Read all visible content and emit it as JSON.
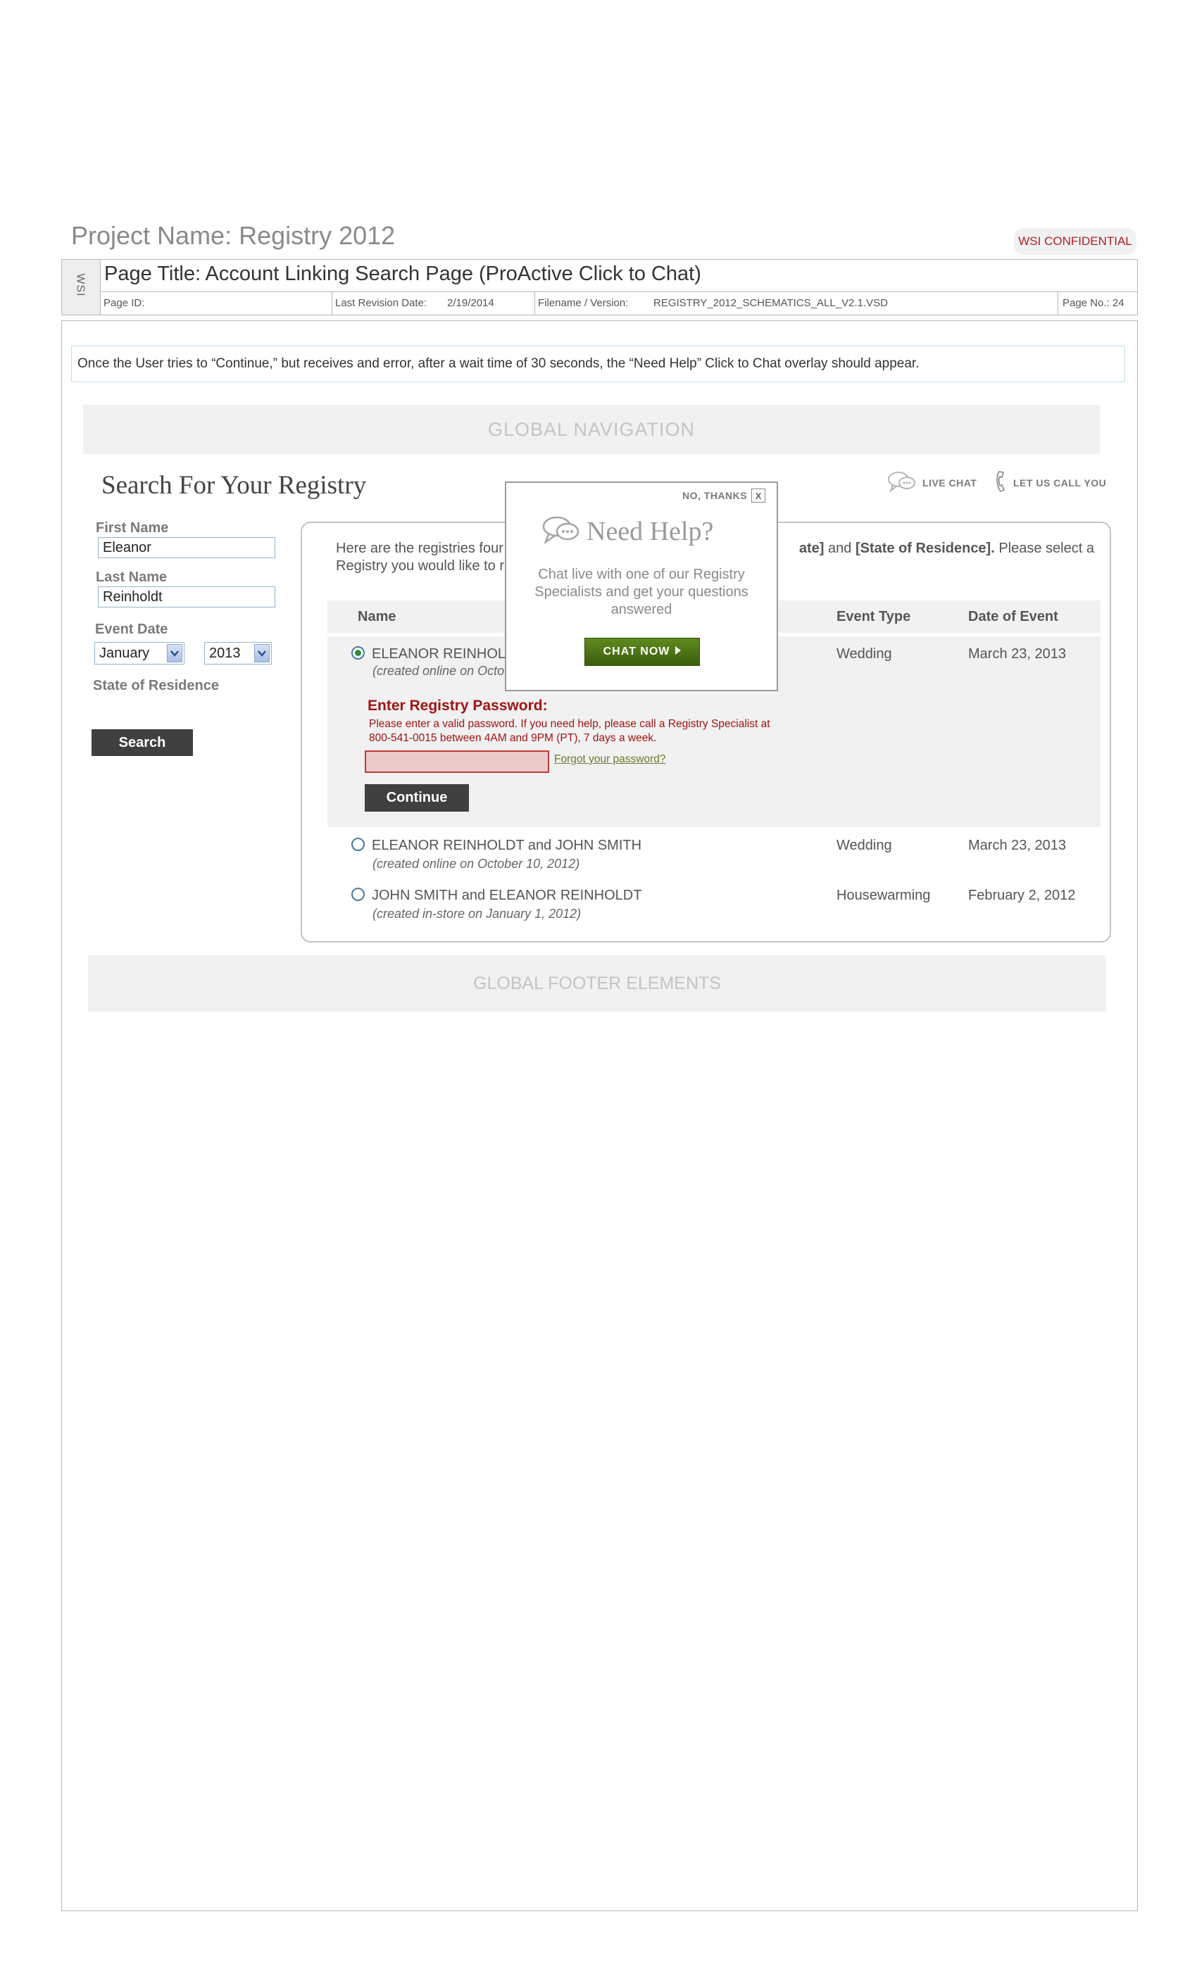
{
  "header": {
    "project_title": "Project Name: Registry 2012",
    "confidential": "WSI CONFIDENTIAL",
    "wsi": "WSI",
    "page_title": "Page Title: Account Linking Search Page (ProActive Click to Chat)",
    "page_id_label": "Page ID:",
    "revision_label": "Last Revision Date:",
    "revision_date": "2/19/2014",
    "filename_label": "Filename / Version:",
    "filename": "REGISTRY_2012_SCHEMATICS_ALL_V2.1.VSD",
    "page_no": "Page No.: 24"
  },
  "note": "Once the User tries to “Continue,” but receives and error, after a wait time of 30 seconds, the “Need Help” Click to Chat overlay should appear.",
  "global_nav": "GLOBAL NAVIGATION",
  "search_heading": "Search For Your Registry",
  "utility": {
    "live_chat": "LIVE CHAT",
    "call_you": "LET US CALL YOU"
  },
  "form": {
    "first_name_label": "First Name",
    "first_name_value": "Eleanor",
    "last_name_label": "Last Name",
    "last_name_value": "Reinholdt",
    "event_date_label": "Event Date",
    "month_value": "January",
    "year_value": "2013",
    "state_label": "State of Residence",
    "search_button": "Search"
  },
  "results": {
    "intro_start": "Here are the registries four",
    "intro_bold1": "ate]",
    "intro_and": " and ",
    "intro_bold2": "[State of Residence].",
    "intro_end": " Please select a",
    "intro_line2": "Registry you would like to r",
    "columns": {
      "name": "Name",
      "event_type": "Event Type",
      "date": "Date of Event"
    },
    "rows": [
      {
        "name": "ELEANOR REINHOL",
        "sub": "(created online on Octo",
        "event_type": "Wedding",
        "date": "March 23, 2013",
        "selected": true
      },
      {
        "name": "ELEANOR REINHOLDT and JOHN SMITH",
        "sub": "(created online on October 10, 2012)",
        "event_type": "Wedding",
        "date": "March 23, 2013",
        "selected": false
      },
      {
        "name": "JOHN SMITH and ELEANOR REINHOLDT",
        "sub": "(created in-store on January 1, 2012)",
        "event_type": "Housewarming",
        "date": "February 2, 2012",
        "selected": false
      }
    ],
    "password_title": "Enter Registry Password:",
    "password_error": "Please enter a valid password. If you need help, please call a Registry Specialist at 800-541-0015 between 4AM and 9PM (PT), 7 days a week.",
    "forgot_link": "Forgot your password?",
    "continue_button": "Continue"
  },
  "global_footer": "GLOBAL FOOTER ELEMENTS",
  "overlay": {
    "no_thanks": "NO, THANKS",
    "close_glyph": "X",
    "title": "Need Help?",
    "copy": "Chat live with one of our Registry Specialists and get your questions answered",
    "chat_button": "CHAT NOW"
  },
  "colors": {
    "error": "#a11414",
    "chat_button": "#4a7216",
    "panel_grey": "#f1f1f1"
  }
}
